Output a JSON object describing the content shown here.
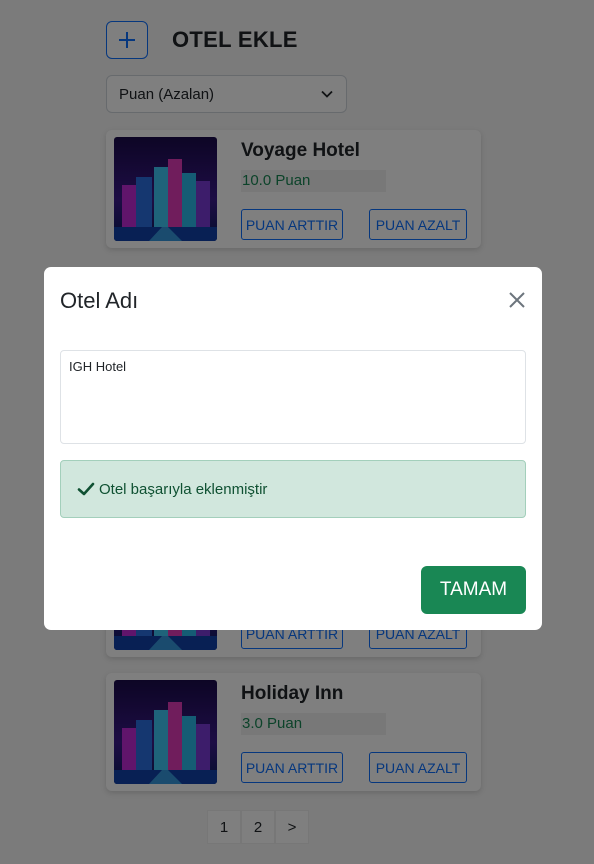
{
  "header": {
    "title": "OTEL EKLE"
  },
  "sort": {
    "selected": "Puan (Azalan)"
  },
  "cards": [
    {
      "name": "Voyage Hotel",
      "score": "10.0 Puan",
      "inc_label": "PUAN ARTTIR",
      "dec_label": "PUAN AZALT"
    },
    {
      "name": "",
      "score": "",
      "inc_label": "PUAN ARTTIR",
      "dec_label": "PUAN AZALT"
    },
    {
      "name": "Holiday Inn",
      "score": "3.0 Puan",
      "inc_label": "PUAN ARTTIR",
      "dec_label": "PUAN AZALT"
    }
  ],
  "pagination": {
    "pages": [
      "1",
      "2"
    ],
    "next": ">"
  },
  "modal": {
    "title": "Otel Adı",
    "input_value": "IGH Hotel",
    "alert_text": "Otel başarıyla eklenmiştir",
    "ok_label": "TAMAM"
  },
  "colors": {
    "primary": "#0d6efd",
    "success": "#198754",
    "alert_bg": "#d1e7dd",
    "alert_text": "#0f5132"
  }
}
